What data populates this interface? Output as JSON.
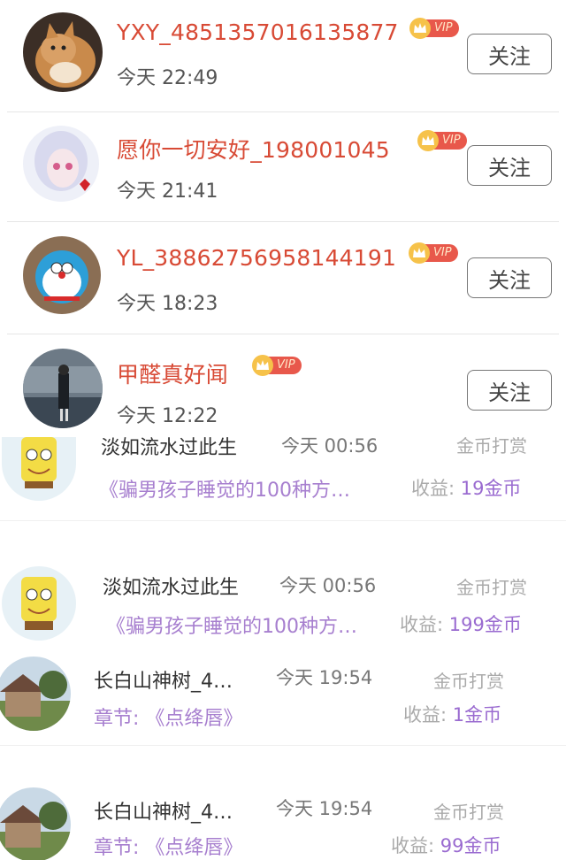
{
  "follow_list": [
    {
      "username": "YXY_4851357016135877",
      "vip_label": "VIP",
      "time": "今天 22:49",
      "follow_label": "关注",
      "avatar": "cat-avatar"
    },
    {
      "username": "愿你一切安好_198001045",
      "vip_label": "VIP",
      "time": "今天 21:41",
      "follow_label": "关注",
      "avatar": "anime-girl-avatar"
    },
    {
      "username": "YL_38862756958144191",
      "vip_label": "VIP",
      "time": "今天 18:23",
      "follow_label": "关注",
      "avatar": "doraemon-avatar"
    },
    {
      "username": "甲醛真好闻",
      "vip_label": "VIP",
      "time": "今天 12:22",
      "follow_label": "关注",
      "avatar": "street-girl-avatar"
    }
  ],
  "reward_list": [
    {
      "name": "淡如流水过此生",
      "time": "今天 00:56",
      "type": "金币打赏",
      "book": "《骗男孩子睡觉的100种方…",
      "gain_label": "收益:",
      "gain_amount": "19金币",
      "avatar": "spongebob-avatar"
    },
    {
      "name": "淡如流水过此生",
      "time": "今天 00:56",
      "type": "金币打赏",
      "book": "《骗男孩子睡觉的100种方…",
      "gain_label": "收益:",
      "gain_amount": "199金币",
      "avatar": "spongebob-avatar"
    },
    {
      "name": "长白山神树_4…",
      "time": "今天 19:54",
      "type": "金币打赏",
      "chapter_label": "章节:",
      "book": "《点绛唇》",
      "gain_label": "收益:",
      "gain_amount": "1金币",
      "avatar": "house-avatar"
    },
    {
      "name": "长白山神树_4…",
      "time": "今天 19:54",
      "type": "金币打赏",
      "chapter_label": "章节:",
      "book": "《点绛唇》",
      "gain_label": "收益:",
      "gain_amount": "99金币",
      "avatar": "house-avatar"
    }
  ],
  "colors": {
    "username": "#d84a35",
    "vip_crown": "#f6c24a",
    "vip_tag": "#e8584b",
    "book_title": "#a77fcf",
    "gain_amount": "#9a6bd0"
  }
}
